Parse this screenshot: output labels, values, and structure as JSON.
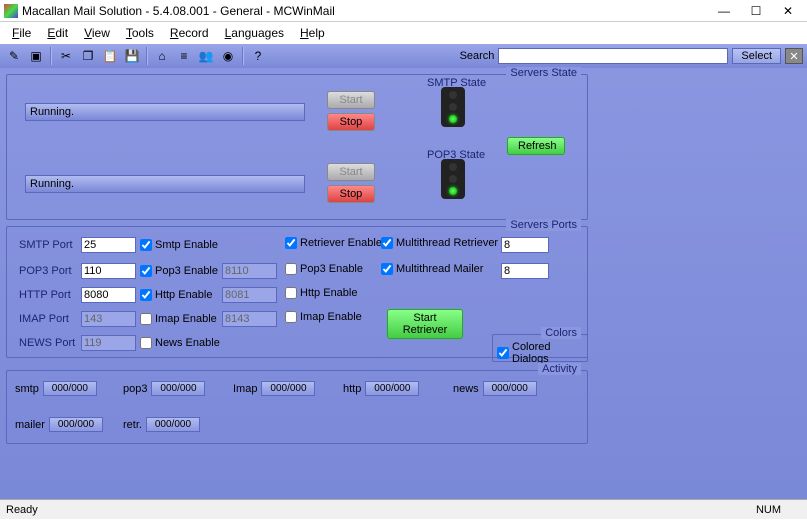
{
  "title": "Macallan Mail Solution - 5.4.08.001 - General - MCWinMail",
  "menu": [
    "File",
    "Edit",
    "View",
    "Tools",
    "Record",
    "Languages",
    "Help"
  ],
  "toolbar": {
    "search_label": "Search",
    "select_btn": "Select"
  },
  "servers_state": {
    "group_title": "Servers State",
    "smtp_label": "SMTP State",
    "pop3_label": "POP3 State",
    "smtp_status": "Running.",
    "pop3_status": "Running.",
    "start": "Start",
    "stop": "Stop",
    "refresh": "Refresh"
  },
  "servers_ports": {
    "group_title": "Servers Ports",
    "rows": {
      "smtp": {
        "label": "SMTP Port",
        "value": "25",
        "enable": "Smtp Enable",
        "checked": true
      },
      "pop3": {
        "label": "POP3 Port",
        "value": "110",
        "enable": "Pop3 Enable",
        "checked": true,
        "value2": "8110",
        "enable2": "Pop3 Enable",
        "checked2": false
      },
      "http": {
        "label": "HTTP Port",
        "value": "8080",
        "enable": "Http Enable",
        "checked": true,
        "value2": "8081",
        "enable2": "Http Enable",
        "checked2": false
      },
      "imap": {
        "label": "IMAP Port",
        "value": "143",
        "enable": "Imap Enable",
        "checked": false,
        "value2": "8143",
        "enable2": "Imap Enable",
        "checked2": false
      },
      "news": {
        "label": "NEWS Port",
        "value": "119",
        "enable": "News Enable",
        "checked": false
      }
    },
    "retriever_enable": "Retriever Enable",
    "multithread_retriever": "Multithread Retriever",
    "multithread_mailer": "Multithread Mailer",
    "mt_retriever_val": "8",
    "mt_mailer_val": "8",
    "start_retriever": "Start Retriever"
  },
  "colors": {
    "group_title": "Colors",
    "colored_dialogs": "Colored Dialogs"
  },
  "activity": {
    "group_title": "Activity",
    "items": {
      "smtp": {
        "label": "smtp",
        "val": "000/000"
      },
      "pop3": {
        "label": "pop3",
        "val": "000/000"
      },
      "imap": {
        "label": "Imap",
        "val": "000/000"
      },
      "http": {
        "label": "http",
        "val": "000/000"
      },
      "news": {
        "label": "news",
        "val": "000/000"
      },
      "mailer": {
        "label": "mailer",
        "val": "000/000"
      },
      "retr": {
        "label": "retr.",
        "val": "000/000"
      }
    }
  },
  "statusbar": {
    "ready": "Ready",
    "num": "NUM"
  }
}
